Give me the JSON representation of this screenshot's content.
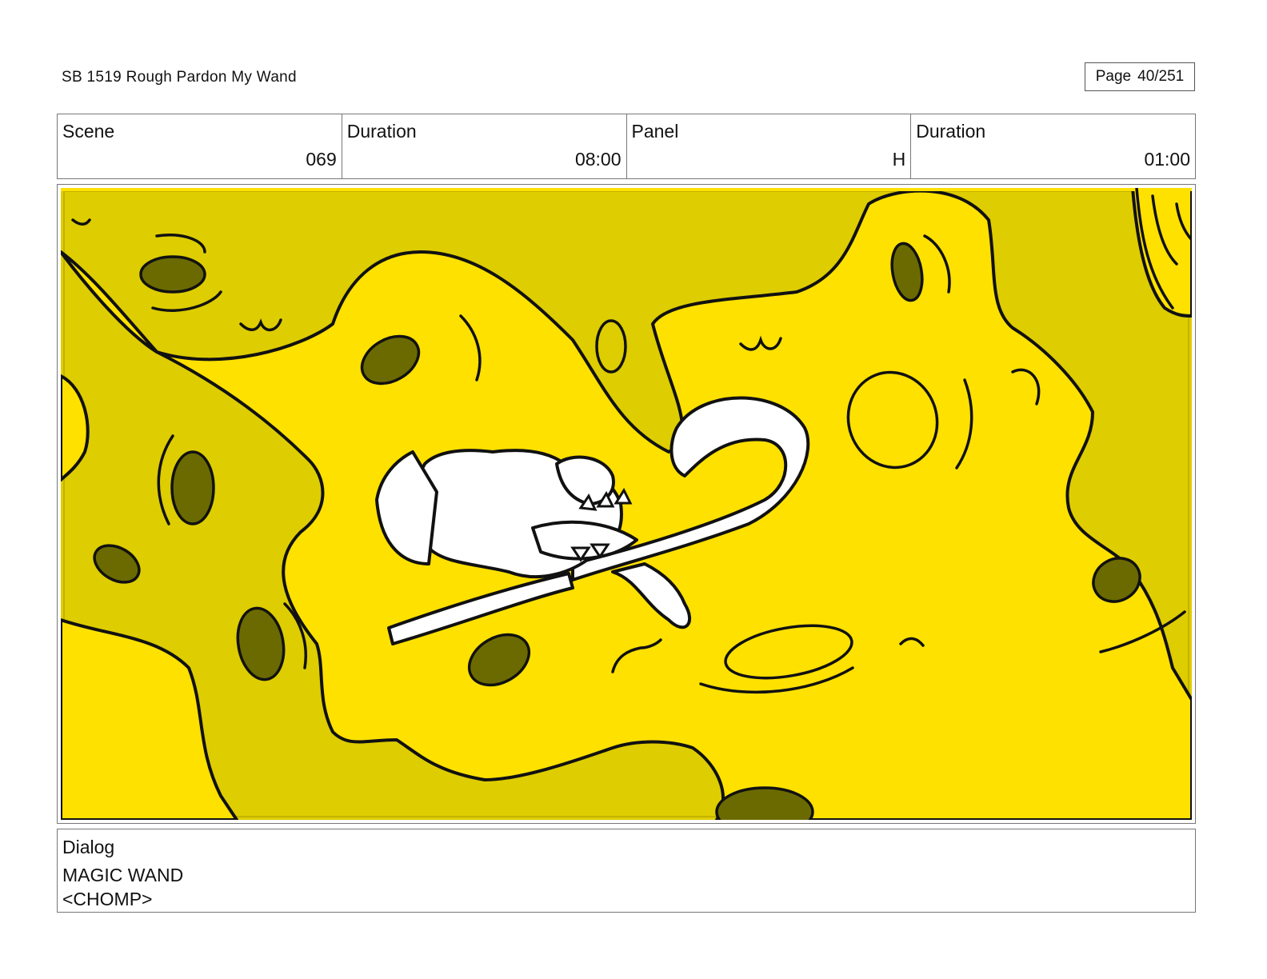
{
  "header": {
    "title": "SB 1519 Rough  Pardon My Wand",
    "page_label": "Page",
    "page_value": "40/251"
  },
  "info": {
    "scene_label": "Scene",
    "scene_value": "069",
    "scene_duration_label": "Duration",
    "scene_duration_value": "08:00",
    "panel_label": "Panel",
    "panel_value": "H",
    "panel_duration_label": "Duration",
    "panel_duration_value": "01:00"
  },
  "drawing": {
    "bg_color": "#decd00",
    "sponge_color": "#ffe100",
    "hole_color": "#6b6a00",
    "ink_color": "#111111",
    "wand_color": "#ffffff"
  },
  "dialog": {
    "label": "Dialog",
    "line1": "MAGIC WAND",
    "line2": "<CHOMP>"
  }
}
